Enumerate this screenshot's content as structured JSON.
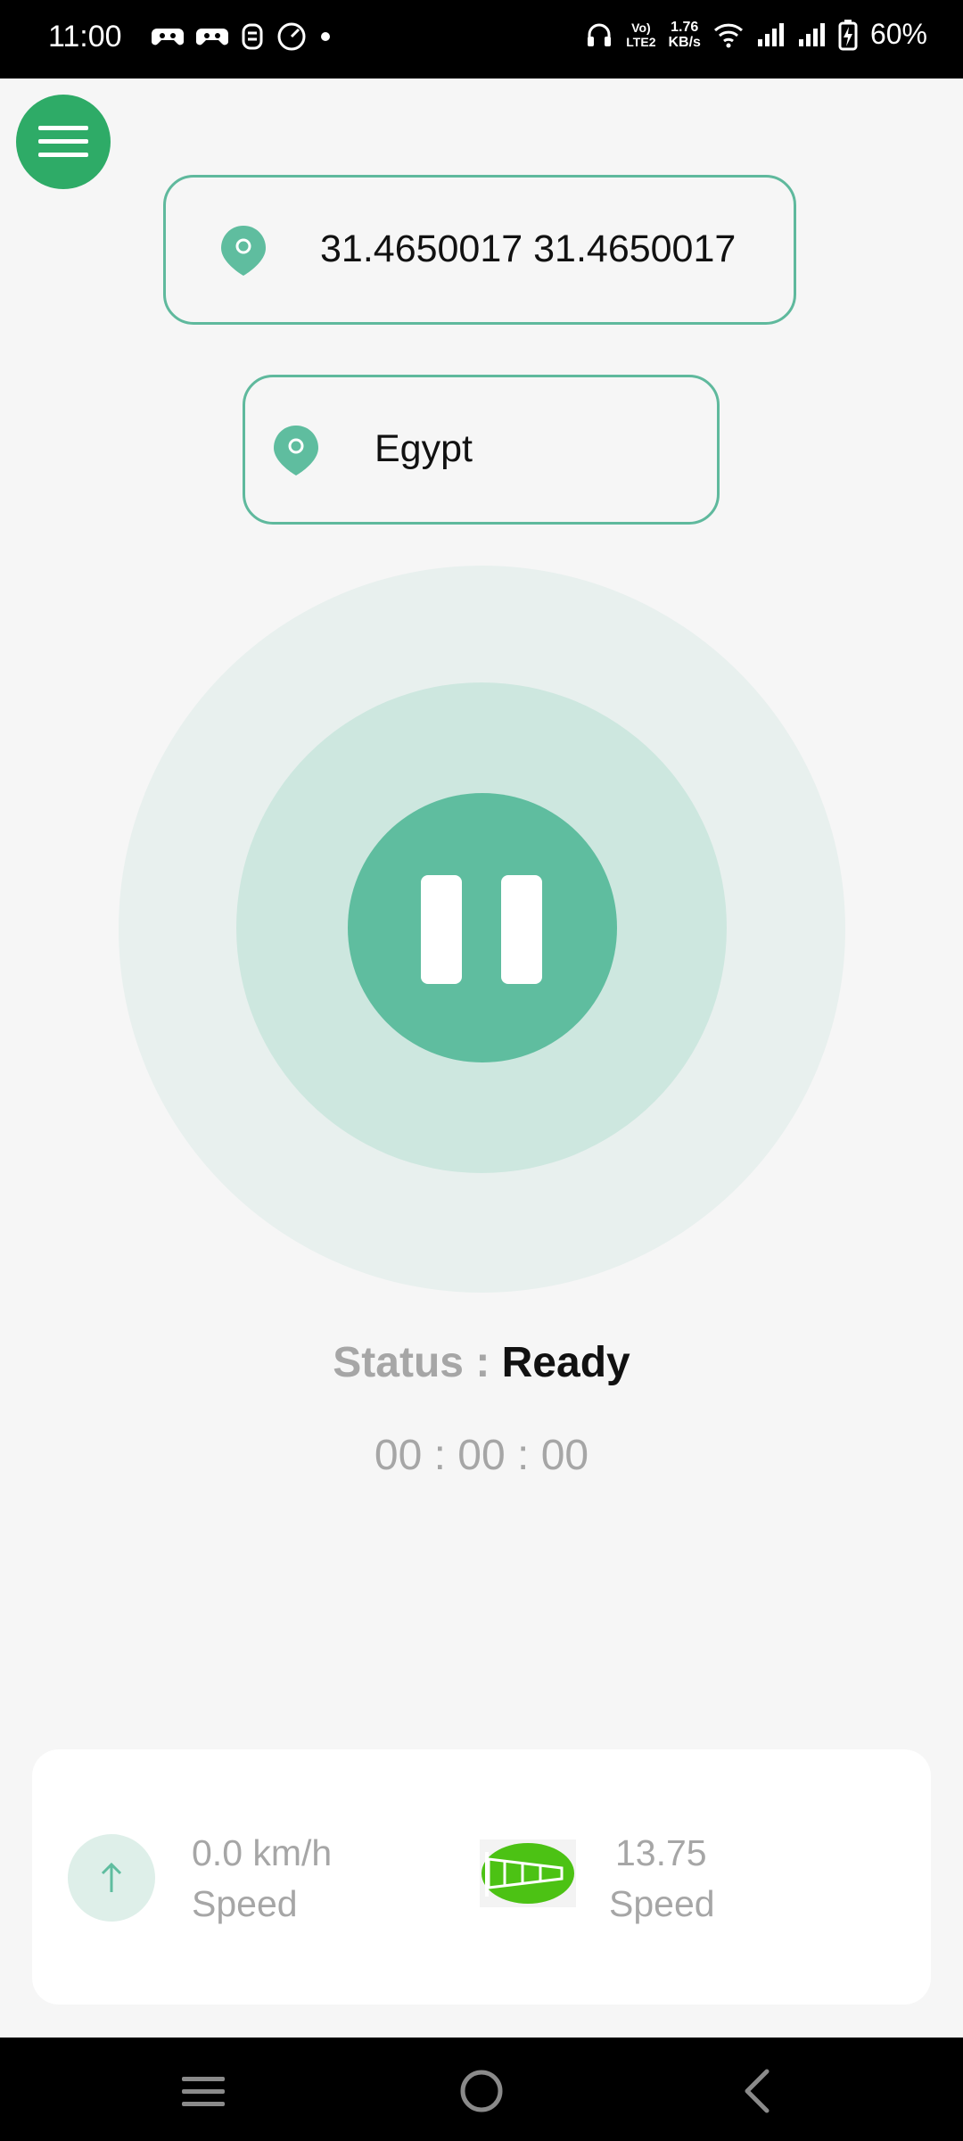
{
  "status_bar": {
    "time": "11:00",
    "volte_line1": "Vo)",
    "volte_line2": "LTE2",
    "net_speed_value": "1.76",
    "net_speed_unit": "KB/s",
    "battery": "60%"
  },
  "location": {
    "coordinates": "31.4650017 31.4650017",
    "country": "Egypt"
  },
  "status": {
    "label": "Status : ",
    "value": "Ready",
    "timer": "00 : 00 : 00"
  },
  "stats": {
    "speed_value": "0.0 km/h",
    "speed_label": "Speed",
    "wind_value": "13.75",
    "wind_label": "Speed"
  },
  "icons": {
    "menu": "hamburger-icon",
    "pin": "location-pin-icon",
    "pause": "pause-icon",
    "speed": "arrow-up-icon",
    "wind": "windsock-icon"
  },
  "colors": {
    "accent": "#2eab67",
    "teal": "#5fbd9f",
    "card_border": "#5fb99d",
    "ring_outer": "#e8f0ee",
    "ring_mid": "#cde7df",
    "muted_text": "#a6a6a6"
  }
}
